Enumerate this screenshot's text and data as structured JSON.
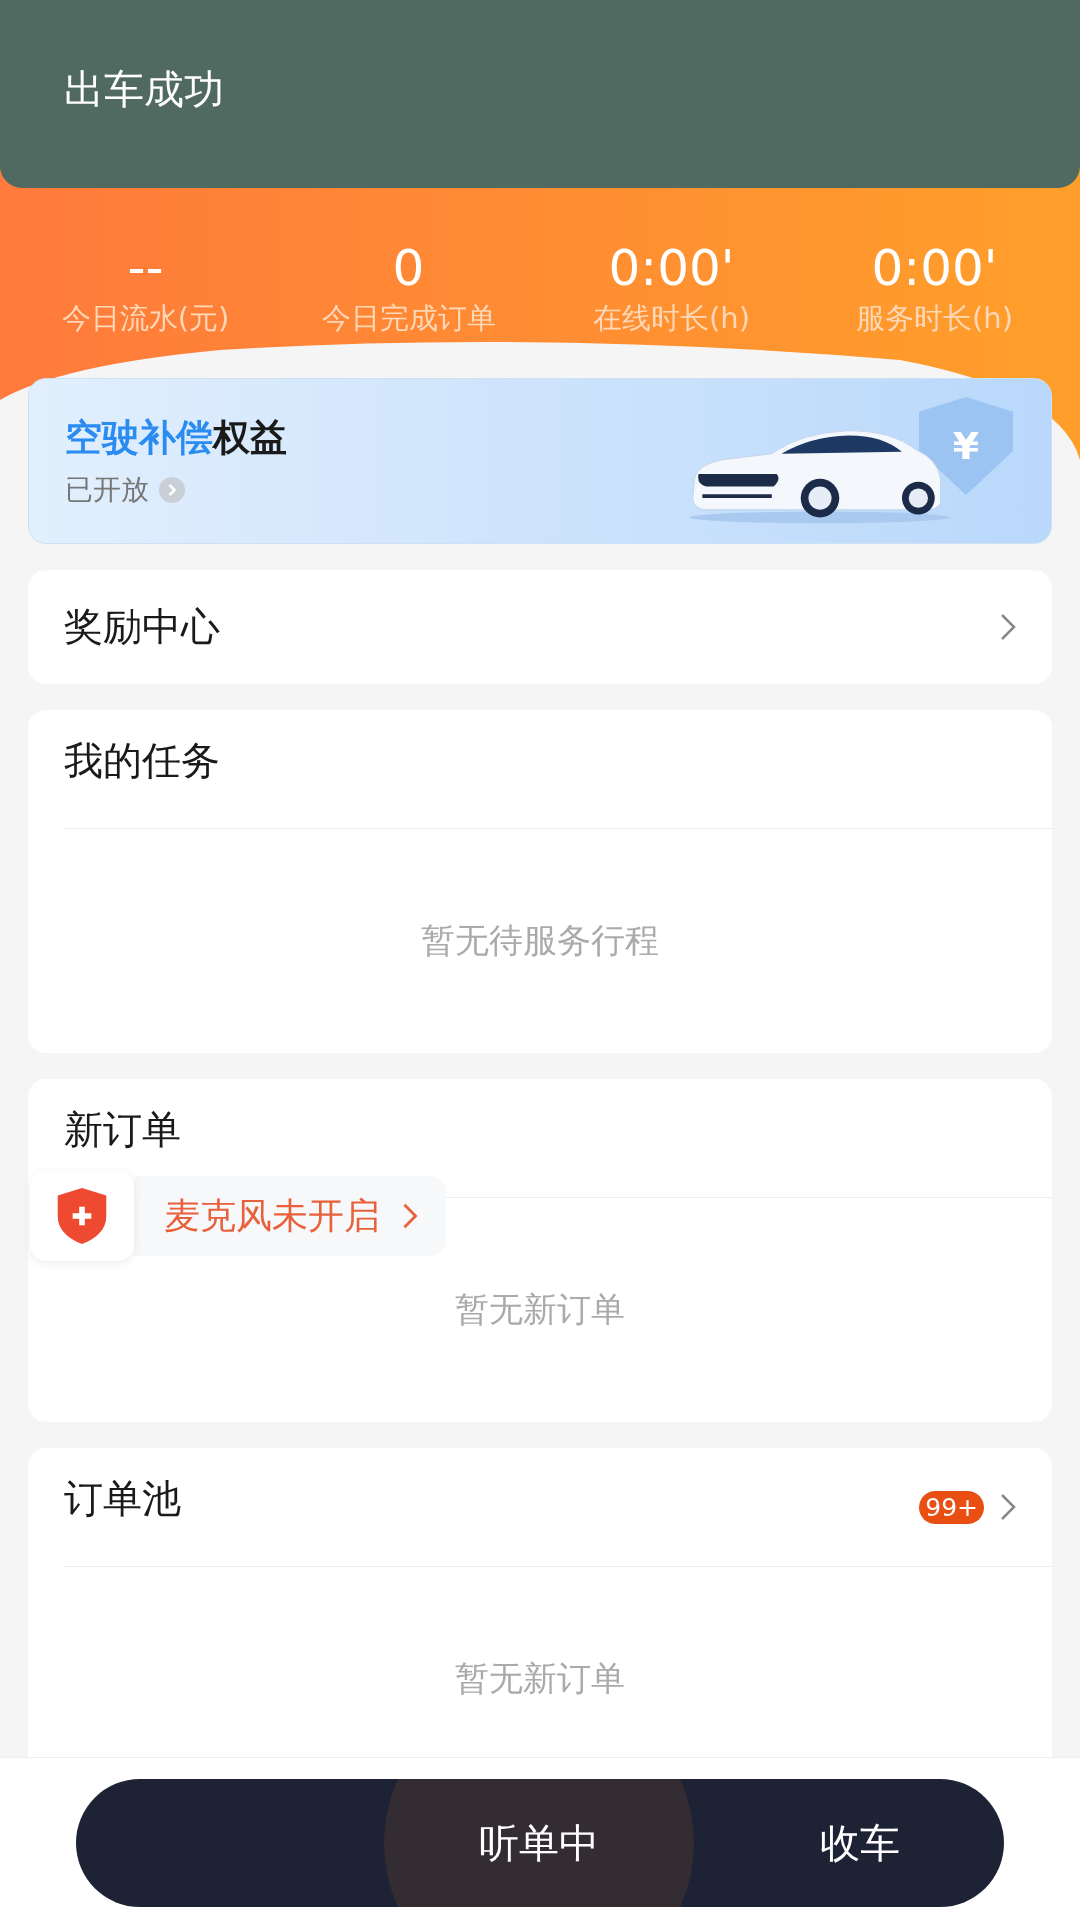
{
  "toast": {
    "message": "出车成功"
  },
  "stats": [
    {
      "value": "--",
      "label": "今日流水(元)"
    },
    {
      "value": "0",
      "label": "今日完成订单"
    },
    {
      "value": "0:00'",
      "label": "在线时长(h)"
    },
    {
      "value": "0:00'",
      "label": "服务时长(h)"
    }
  ],
  "benefit_card": {
    "title_highlight": "空驶补偿",
    "title_rest": "权益",
    "status": "已开放",
    "currency_symbol": "¥"
  },
  "reward_center": {
    "title": "奖励中心"
  },
  "sections": [
    {
      "title": "我的任务",
      "empty_text": "暂无待服务行程"
    },
    {
      "title": "新订单",
      "empty_text": "暂无新订单"
    },
    {
      "title": "订单池",
      "badge": "99+",
      "empty_text": "暂无新订单"
    }
  ],
  "mic_alert": {
    "text": "麦克风未开启"
  },
  "action_bar": {
    "items": [
      {
        "label": "听单中",
        "selected": true
      },
      {
        "label": "收车",
        "selected": false
      }
    ]
  }
}
